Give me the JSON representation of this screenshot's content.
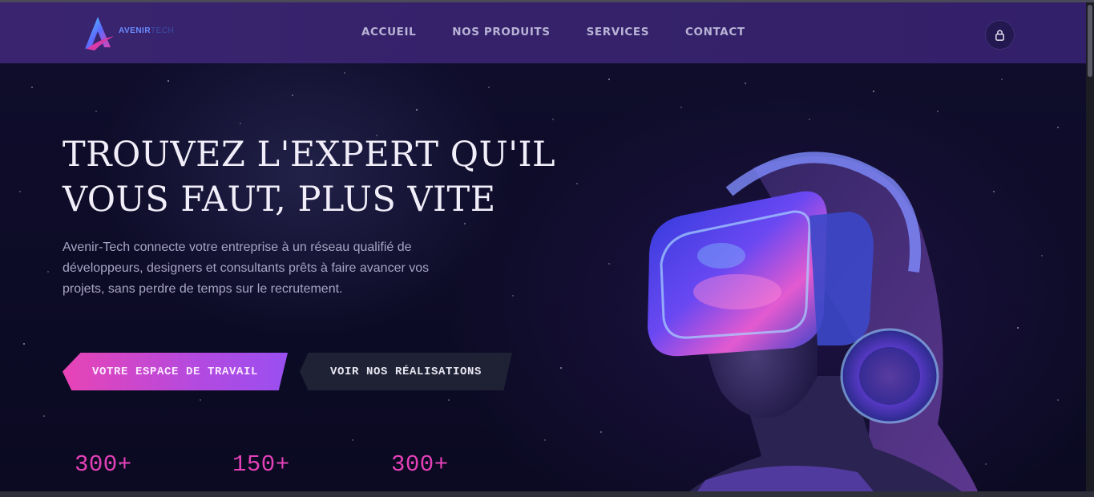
{
  "brand": {
    "name_part1": "AVENIR",
    "name_part2": "TECH"
  },
  "nav": {
    "items": [
      {
        "label": "ACCUEIL"
      },
      {
        "label": "NOS PRODUITS"
      },
      {
        "label": "SERVICES"
      },
      {
        "label": "CONTACT"
      }
    ],
    "account_icon": "lock-icon"
  },
  "hero": {
    "title_line1": "TROUVEZ L'EXPERT QU'IL",
    "title_line2": "VOUS FAUT, PLUS VITE",
    "description": "Avenir-Tech connecte votre entreprise à un réseau qualifié de développeurs, designers et consultants prêts à faire avancer vos projets, sans perdre de temps sur le recrutement.",
    "primary_button": "VOTRE ESPACE DE TRAVAIL",
    "secondary_button": "VOIR NOS RÉALISATIONS"
  },
  "stats": [
    {
      "value": "300+"
    },
    {
      "value": "150+"
    },
    {
      "value": "300+"
    }
  ],
  "colors": {
    "navbar": "#36226c",
    "accent_pink": "#e441b8",
    "accent_purple": "#9a4ff0",
    "background": "#0b0a20"
  }
}
